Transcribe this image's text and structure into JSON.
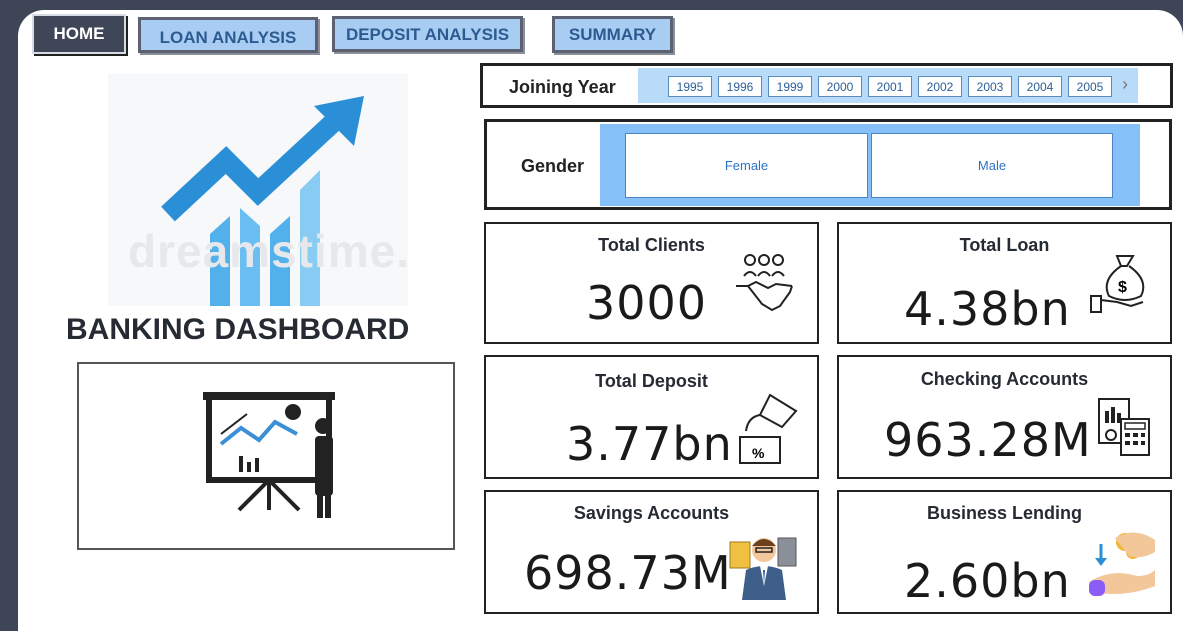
{
  "nav": {
    "home": "HOME",
    "loan_analysis": "LOAN ANALYSIS",
    "deposit_analysis": "DEPOSIT ANALYSIS",
    "summary": "SUMMARY"
  },
  "hero": {
    "watermark": "dreamstime.",
    "title": "BANKING DASHBOARD"
  },
  "filters": {
    "joining_year": {
      "label": "Joining Year",
      "options": [
        "1995",
        "1996",
        "1999",
        "2000",
        "2001",
        "2002",
        "2003",
        "2004",
        "2005"
      ]
    },
    "gender": {
      "label": "Gender",
      "options": [
        "Female",
        "Male"
      ]
    }
  },
  "kpis": {
    "total_clients": {
      "label": "Total Clients",
      "value": "3000"
    },
    "total_loan": {
      "label": "Total Loan",
      "value": "4.38bn"
    },
    "total_deposit": {
      "label": "Total Deposit",
      "value": "3.77bn"
    },
    "checking_accounts": {
      "label": "Checking Accounts",
      "value": "963.28M"
    },
    "savings_accounts": {
      "label": "Savings Accounts",
      "value": "698.73M"
    },
    "business_lending": {
      "label": "Business Lending",
      "value": "2.60bn"
    }
  },
  "colors": {
    "page_bg": "#3d4556",
    "tab_fill": "#a9cdf2",
    "slicer_fill": "#85c0f9",
    "accent_blue": "#2a8fd6"
  }
}
